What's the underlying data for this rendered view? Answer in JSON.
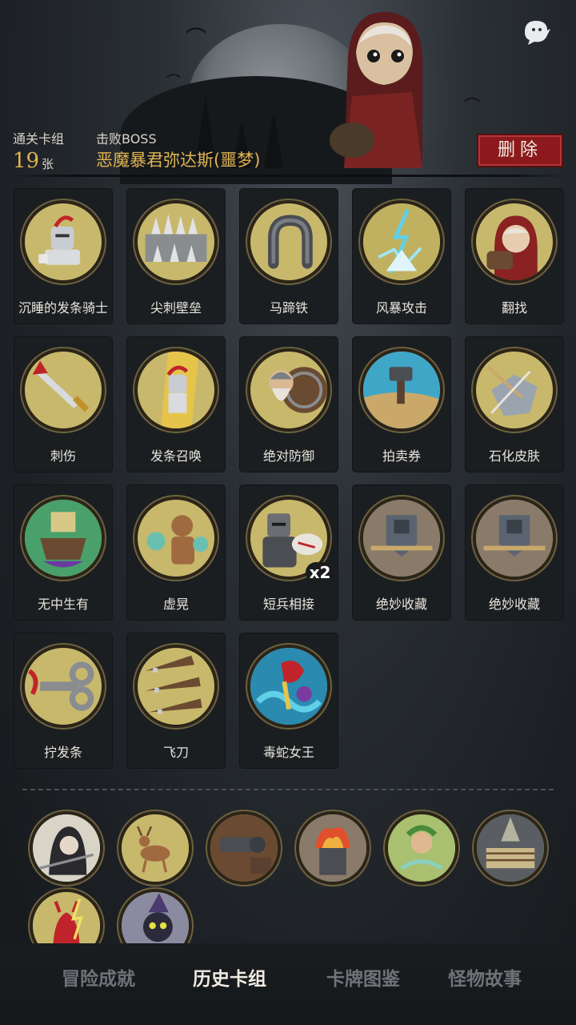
{
  "header": {
    "deck_label": "通关卡组",
    "boss_label": "击败BOSS",
    "deck_count": "19",
    "deck_unit": "张",
    "boss_name": "恶魔暴君弥达斯(噩梦)",
    "delete_label": "删除"
  },
  "cards": [
    {
      "name": "沉睡的发条骑士",
      "icon": "sleeping-knight-icon"
    },
    {
      "name": "尖刺壁垒",
      "icon": "spike-wall-icon"
    },
    {
      "name": "马蹄铁",
      "icon": "horseshoe-icon"
    },
    {
      "name": "风暴攻击",
      "icon": "lightning-icon"
    },
    {
      "name": "翻找",
      "icon": "red-hood-girl-icon"
    },
    {
      "name": "刺伤",
      "icon": "dagger-icon"
    },
    {
      "name": "发条召唤",
      "icon": "clockwork-knight-icon"
    },
    {
      "name": "绝对防御",
      "icon": "dwarf-shield-icon"
    },
    {
      "name": "拍卖券",
      "icon": "auction-hammer-icon"
    },
    {
      "name": "石化皮肤",
      "icon": "stone-skin-icon"
    },
    {
      "name": "无中生有",
      "icon": "box-creation-icon"
    },
    {
      "name": "虚晃",
      "icon": "boxer-icon"
    },
    {
      "name": "短兵相接",
      "icon": "armored-knight-icon",
      "multiplier": "x2"
    },
    {
      "name": "绝妙收藏",
      "icon": "treasure-collection-icon"
    },
    {
      "name": "绝妙收藏",
      "icon": "treasure-collection-icon"
    },
    {
      "name": "拧发条",
      "icon": "wind-up-key-icon"
    },
    {
      "name": "飞刀",
      "icon": "throwing-knives-icon"
    },
    {
      "name": "毒蛇女王",
      "icon": "serpent-queen-icon"
    }
  ],
  "relics": [
    {
      "icon": "hooded-reaper-icon"
    },
    {
      "icon": "deer-icon"
    },
    {
      "icon": "cannon-icon"
    },
    {
      "icon": "fire-altar-icon"
    },
    {
      "icon": "forest-spirit-icon"
    },
    {
      "icon": "boxing-ring-icon"
    },
    {
      "icon": "red-imp-icon"
    },
    {
      "icon": "black-cat-witch-icon"
    }
  ],
  "tabs": [
    {
      "label": "冒险成就",
      "active": false
    },
    {
      "label": "历史卡组",
      "active": true
    },
    {
      "label": "卡牌图鉴",
      "active": false
    },
    {
      "label": "怪物故事",
      "active": false
    }
  ],
  "colors": {
    "accent_gold": "#e0b452",
    "delete_red": "#8c1a1c",
    "card_bg": "#1b1e21",
    "art_bg": "#c8b86c"
  }
}
